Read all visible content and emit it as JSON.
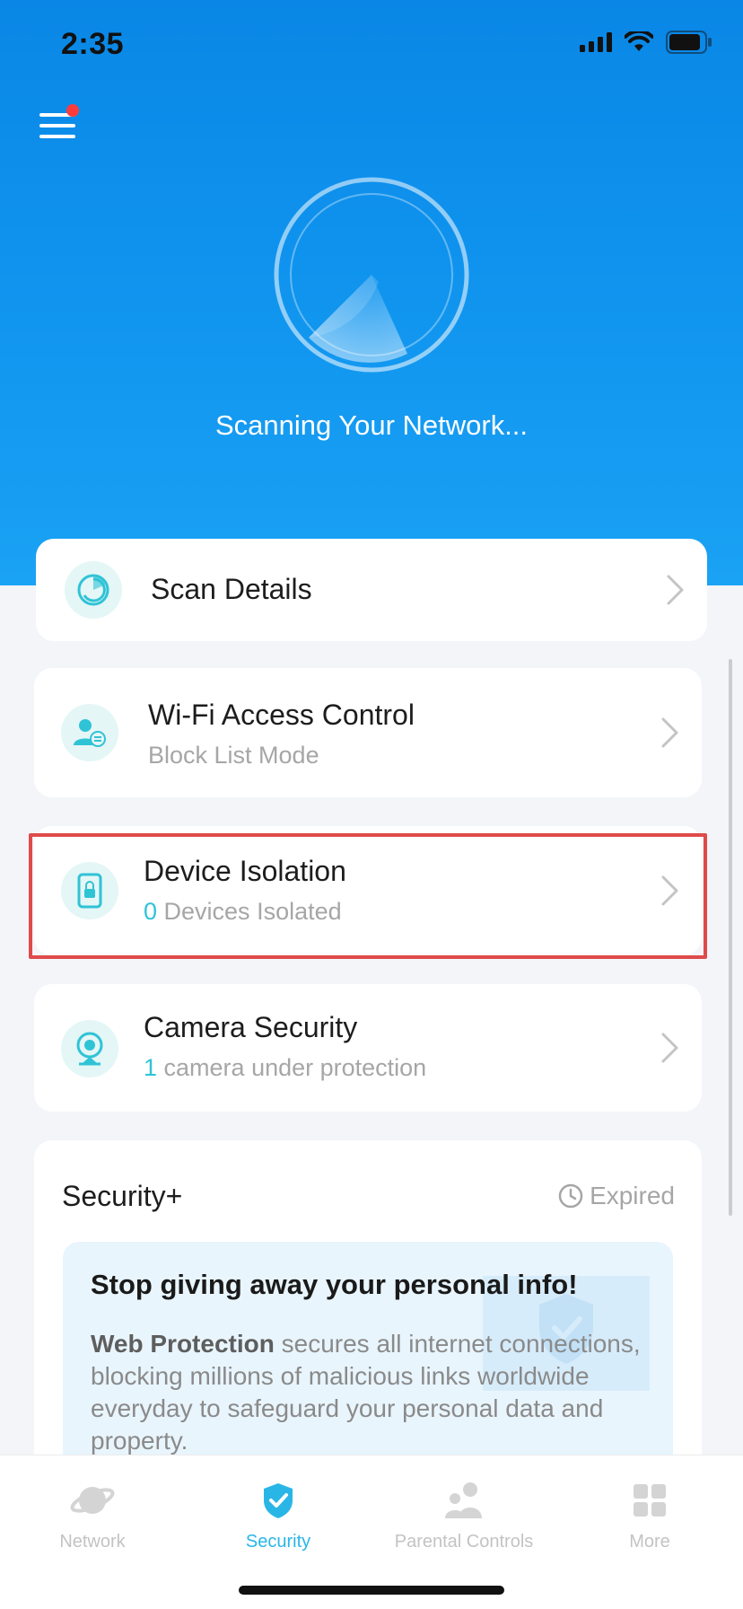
{
  "status_bar": {
    "time": "2:35"
  },
  "hero": {
    "scan_text": "Scanning Your Network..."
  },
  "scan_details": {
    "title": "Scan Details"
  },
  "wifi_access": {
    "title": "Wi-Fi Access Control",
    "subtitle": "Block List Mode"
  },
  "device_isolation": {
    "title": "Device Isolation",
    "count": "0",
    "subtitle": " Devices Isolated"
  },
  "camera_security": {
    "title": "Camera Security",
    "count": "1",
    "subtitle": " camera under protection"
  },
  "security_plus": {
    "title": "Security+",
    "status": "Expired",
    "promo_heading": "Stop giving away your personal info!",
    "promo_bold": "Web Protection",
    "promo_body": " secures all internet connections, blocking millions of malicious links worldwide everyday to safeguard your personal data and property."
  },
  "tabs": [
    {
      "label": "Network",
      "icon": "planet-icon"
    },
    {
      "label": "Security",
      "icon": "shield-check-icon"
    },
    {
      "label": "Parental Controls",
      "icon": "family-icon"
    },
    {
      "label": "More",
      "icon": "grid-icon"
    }
  ],
  "colors": {
    "hero_blue": "#0a87e6",
    "accent_teal": "#2fc3d6",
    "active_tab": "#29b6e6",
    "highlight_red": "#e04a4a"
  }
}
